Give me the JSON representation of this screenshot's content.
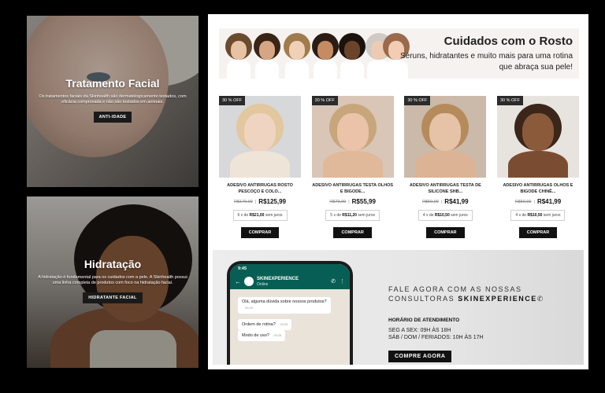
{
  "promos": [
    {
      "title": "Tratamento Facial",
      "description": "Os tratamentos faciais da Skinhealth são dermatologicamente testados, com eficácia comprovada e não são testados em animais.",
      "button": "ANTI-IDADE"
    },
    {
      "title": "Hidratação",
      "description": "A hidratação é fundamental para os cuidados com a pele. A Skinhealth possui uma linha completa de produtos com foco na hidratação facial.",
      "button": "HIDRATANTE FACIAL"
    }
  ],
  "banner": {
    "title": "Cuidados com o Rosto",
    "subtitle": "Séruns, hidratantes e muito mais para uma rotina que abraça sua pele!"
  },
  "products": [
    {
      "badge": "30 % OFF",
      "name": "ADESIVO ANTIRRUGAS ROSTO PESCOÇO E COLO...",
      "old_price": "R$179,99",
      "new_price": "R$125,99",
      "installments_count": "6 x de",
      "installment_value": "R$21,00",
      "installment_suffix": "sem juros",
      "button": "COMPRAR"
    },
    {
      "badge": "30 % OFF",
      "name": "ADESIVO ANTIRRUGAS TESTA OLHOS E BIGODE...",
      "old_price": "R$79,99",
      "new_price": "R$55,99",
      "installments_count": "5 x de",
      "installment_value": "R$11,20",
      "installment_suffix": "sem juros",
      "button": "COMPRAR"
    },
    {
      "badge": "30 % OFF",
      "name": "ADESIVO ANTIRRUGAS TESTA DE SILICONE SHB...",
      "old_price": "R$59,99",
      "new_price": "R$41,99",
      "installments_count": "4 x de",
      "installment_value": "R$10,50",
      "installment_suffix": "sem juros",
      "button": "COMPRAR"
    },
    {
      "badge": "30 % OFF",
      "name": "ADESIVO ANTIRRUGAS OLHOS E BIGODE CHINÊ...",
      "old_price": "R$59,99",
      "new_price": "R$41,99",
      "installments_count": "4 x de",
      "installment_value": "R$10,50",
      "installment_suffix": "sem juros",
      "button": "COMPRAR"
    }
  ],
  "whatsapp": {
    "time": "9:45",
    "contact_name": "SKINEXPERIENCE",
    "contact_status": "Online",
    "messages": [
      {
        "text": "Olá, alguma dúvida sobre nossos produtos?",
        "time": "09:25"
      },
      {
        "text": "Ordem de rotina?",
        "time": "09:25"
      },
      {
        "text": "Modo de uso?",
        "time": "09:25"
      }
    ],
    "title_line1": "FALE AGORA COM AS NOSSAS",
    "title_line2": "CONSULTORAS",
    "title_brand": "SKINEXPERIENCE",
    "hours_label": "HORÁRIO DE ATENDIMENTO",
    "hours_weekday": "SEG A SEX: 09H ÀS 18H",
    "hours_weekend": "SÁB / DOM / FERIADOS: 10H ÀS 17H",
    "button": "COMPRE AGORA"
  }
}
